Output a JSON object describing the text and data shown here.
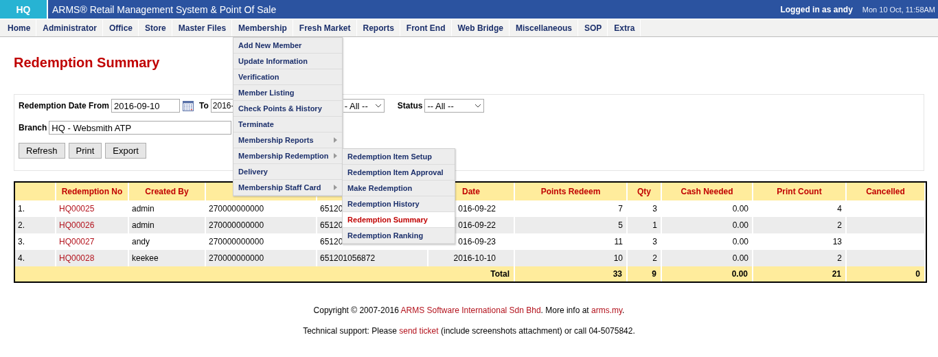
{
  "header": {
    "branch": "HQ",
    "title": "ARMS® Retail Management System & Point Of Sale",
    "user": "Logged in as andy",
    "datetime": "Mon 10 Oct, 11:58AM"
  },
  "nav": [
    {
      "label": "Home"
    },
    {
      "label": "Administrator"
    },
    {
      "label": "Office"
    },
    {
      "label": "Store"
    },
    {
      "label": "Master Files"
    },
    {
      "label": "Membership",
      "menu": [
        {
          "label": "Add New Member",
          "arrow": false
        },
        {
          "label": "Update Information",
          "arrow": false
        },
        {
          "label": "Verification",
          "arrow": false
        },
        {
          "label": "Member Listing",
          "arrow": false
        },
        {
          "label": "Check Points & History",
          "arrow": false
        },
        {
          "label": "Terminate",
          "arrow": false
        },
        {
          "label": "Membership Reports",
          "arrow": true
        },
        {
          "label": "Membership Redemption",
          "arrow": true,
          "children": [
            {
              "label": "Redemption Item Setup",
              "selected": false
            },
            {
              "label": "Redemption Item Approval",
              "selected": false
            },
            {
              "label": "Make Redemption",
              "selected": false
            },
            {
              "label": "Redemption History",
              "selected": false
            },
            {
              "label": "Redemption Summary",
              "selected": true
            },
            {
              "label": "Redemption Ranking",
              "selected": false
            }
          ]
        },
        {
          "label": "Delivery",
          "arrow": false
        },
        {
          "label": "Membership Staff Card",
          "arrow": true
        }
      ]
    },
    {
      "label": "Fresh Market"
    },
    {
      "label": "Reports"
    },
    {
      "label": "Front End"
    },
    {
      "label": "Web Bridge"
    },
    {
      "label": "Miscellaneous"
    },
    {
      "label": "SOP"
    },
    {
      "label": "Extra"
    }
  ],
  "page_title": "Redemption Summary",
  "filters": {
    "date_from_label": "Redemption Date From",
    "date_from": "2016-09-10",
    "date_to_label": "To",
    "date_to": "2016-",
    "select_3": "- All --",
    "status_label": "Status",
    "status": "-- All --",
    "branch_label": "Branch",
    "branch": "HQ - Websmith ATP"
  },
  "buttons": [
    "Refresh",
    "Print",
    "Export"
  ],
  "table": {
    "columns": [
      {},
      {
        "label": "Redemption No"
      },
      {
        "label": "Created By"
      },
      {},
      {},
      {
        "label": "Date"
      },
      {
        "label": "Points Redeem"
      },
      {
        "label": "Qty"
      },
      {
        "label": "Cash Needed"
      },
      {
        "label": "Print Count"
      },
      {
        "label": "Cancelled"
      }
    ],
    "rows": [
      {
        "index": "1.",
        "redemption_no": "HQ00025",
        "created_by": "admin",
        "column_4": "270000000000",
        "column_5": "65120",
        "date": "016-09-22",
        "points": "7",
        "qty": "3",
        "cash": "0.00",
        "print_count": "4"
      },
      {
        "index": "2.",
        "redemption_no": "HQ00026",
        "created_by": "admin",
        "column_4": "270000000000",
        "column_5": "65120",
        "date": "016-09-22",
        "points": "5",
        "qty": "1",
        "cash": "0.00",
        "print_count": "2"
      },
      {
        "index": "3.",
        "redemption_no": "HQ00027",
        "created_by": "andy",
        "column_4": "270000000000",
        "column_5": "65120",
        "date": "016-09-23",
        "points": "11",
        "qty": "3",
        "cash": "0.00",
        "print_count": "13"
      },
      {
        "index": "4.",
        "redemption_no": "HQ00028",
        "created_by": "keekee",
        "column_4": "270000000000",
        "column_5": "651201056872",
        "date": "2016-10-10",
        "points": "10",
        "qty": "2",
        "cash": "0.00",
        "print_count": "2"
      }
    ],
    "total": {
      "label": "Total",
      "points": "33",
      "qty": "9",
      "cash": "0.00",
      "print_count": "21",
      "cancelled": "0"
    }
  },
  "footer": [
    [
      {
        "text": "Copyright © 2007-2016 ",
        "link": false
      },
      {
        "text": "ARMS Software International Sdn Bhd",
        "link": true
      },
      {
        "text": ". More info at ",
        "link": false
      },
      {
        "text": "arms.my",
        "link": true
      },
      {
        "text": ".",
        "link": false
      }
    ],
    [
      {
        "text": "Technical support: Please ",
        "link": false
      },
      {
        "text": "send ticket",
        "link": true
      },
      {
        "text": " (include screenshots attachment) or call 04-5075842.",
        "link": false
      }
    ]
  ]
}
